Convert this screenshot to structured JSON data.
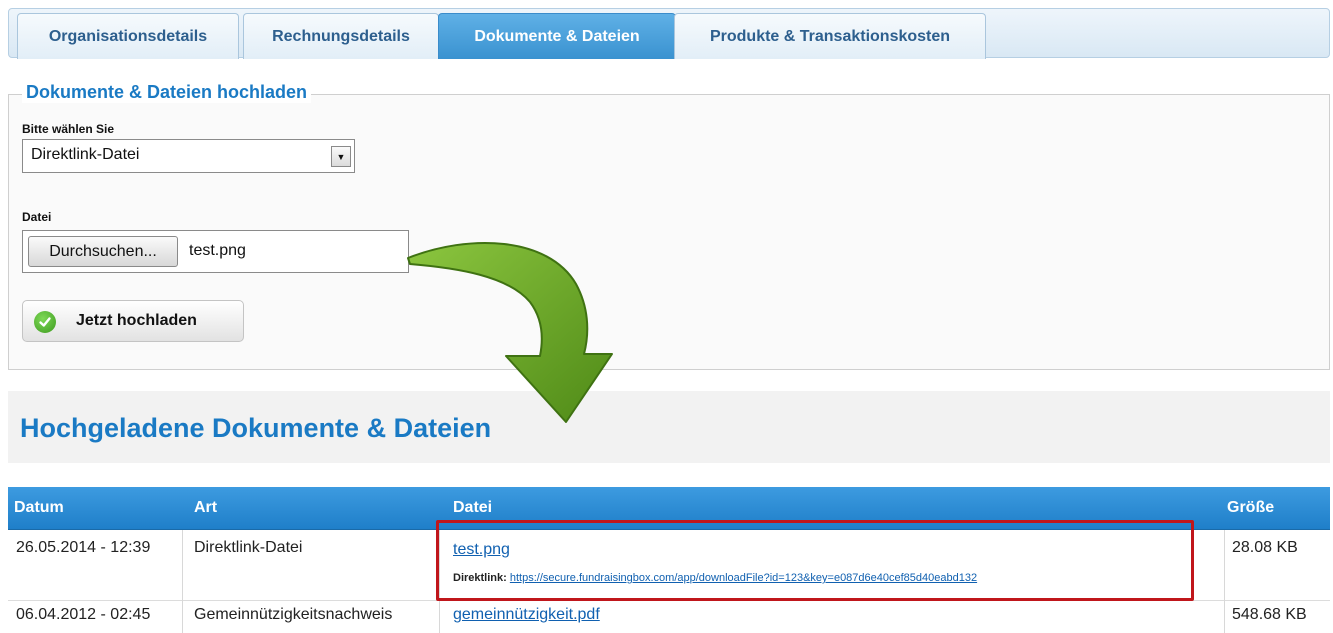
{
  "tabs": [
    {
      "label": "Organisationsdetails",
      "active": false
    },
    {
      "label": "Rechnungsdetails",
      "active": false
    },
    {
      "label": "Dokumente & Dateien",
      "active": true
    },
    {
      "label": "Produkte & Transaktionskosten",
      "active": false
    }
  ],
  "upload": {
    "legend": "Dokumente & Dateien hochladen",
    "select_label": "Bitte wählen Sie",
    "select_value": "Direktlink-Datei",
    "file_label": "Datei",
    "browse_label": "Durchsuchen...",
    "file_name": "test.png",
    "submit_label": "Jetzt hochladen"
  },
  "uploaded": {
    "title": "Hochgeladene Dokumente & Dateien",
    "columns": [
      "Datum",
      "Art",
      "Datei",
      "Größe"
    ],
    "rows": [
      {
        "date": "26.05.2014 - 12:39",
        "type": "Direktlink-Datei",
        "file": "test.png",
        "direct_label": "Direktlink:",
        "direct_url": "https://secure.fundraisingbox.com/app/downloadFile?id=123&key=e087d6e40cef85d40eabd132",
        "size": "28.08 KB"
      },
      {
        "date": "06.04.2012 - 02:45",
        "type": "Gemeinnützigkeitsnachweis",
        "file": "gemeinnützigkeit.pdf",
        "size": "548.68 KB"
      }
    ]
  },
  "colors": {
    "accent": "#1a7ac4",
    "table_header": "#2a8ad3",
    "highlight": "#c0161b",
    "arrow": "#5e9e1e"
  }
}
